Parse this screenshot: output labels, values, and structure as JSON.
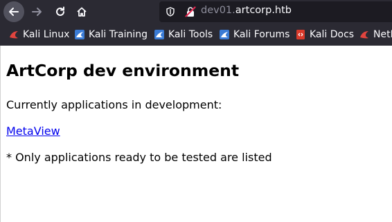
{
  "browser": {
    "nav": {
      "back_icon": "arrow-left-icon",
      "forward_icon": "arrow-right-icon",
      "reload_icon": "reload-icon",
      "home_icon": "home-icon"
    },
    "urlbar": {
      "prefix": "dev01.",
      "domain": "artcorp.htb",
      "shield_icon": "tracking-shield-icon",
      "lock_icon": "insecure-lock-icon"
    },
    "bookmarks": [
      {
        "label": "Kali Linux",
        "icon": "kali-dragon-icon",
        "color": "#e0443e"
      },
      {
        "label": "Kali Training",
        "icon": "kali-training-icon",
        "color": "#3a7bd5"
      },
      {
        "label": "Kali Tools",
        "icon": "kali-tools-icon",
        "color": "#3a7bd5"
      },
      {
        "label": "Kali Forums",
        "icon": "kali-forums-icon",
        "color": "#3a7bd5"
      },
      {
        "label": "Kali Docs",
        "icon": "kali-docs-icon",
        "color": "#d93a2b"
      },
      {
        "label": "NetH",
        "icon": "nethunter-icon",
        "color": "#e0443e"
      }
    ]
  },
  "page": {
    "heading": "ArtCorp dev environment",
    "intro": "Currently applications in development:",
    "app_link": "MetaView",
    "note": "* Only applications ready to be tested are listed"
  },
  "colors": {
    "chrome_bg": "#2b2a33",
    "urlbar_bg": "#1c1b22",
    "link": "#0000ee"
  }
}
